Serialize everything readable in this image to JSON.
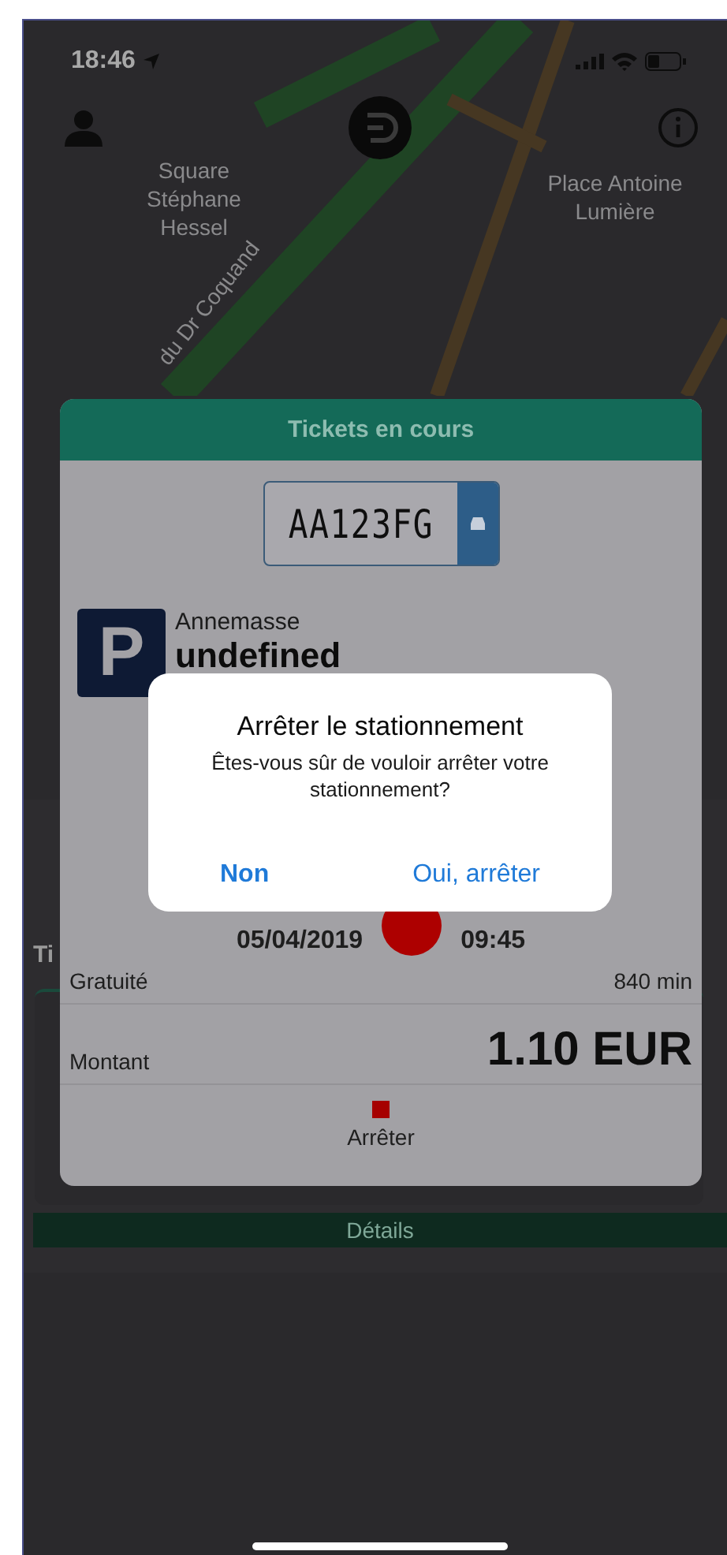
{
  "status_bar": {
    "time": "18:46"
  },
  "map": {
    "labels": [
      "Square Stéphane Hessel",
      "Place Antoine Lumière",
      "du Dr Coquand"
    ]
  },
  "background_list": {
    "heading": "Ti",
    "button": "Détails"
  },
  "ticket_card": {
    "title": "Tickets en cours",
    "plate": "AA123FG",
    "parking_sign": "P",
    "city": "Annemasse",
    "zone": "undefined",
    "date": "05/04/2019",
    "time": "09:45",
    "rows": [
      {
        "label": "Gratuité",
        "value": "840 min",
        "kind": "small"
      },
      {
        "label": "Montant",
        "value": "1.10 EUR",
        "kind": "large"
      }
    ],
    "stop_button": "Arrêter"
  },
  "dialog": {
    "title": "Arrêter le stationnement",
    "message": "Êtes-vous sûr de vouloir arrêter votre stationnement?",
    "buttons": [
      {
        "label": "Non",
        "kind": "cancel"
      },
      {
        "label": "Oui, arrêter",
        "kind": "confirm"
      }
    ]
  }
}
